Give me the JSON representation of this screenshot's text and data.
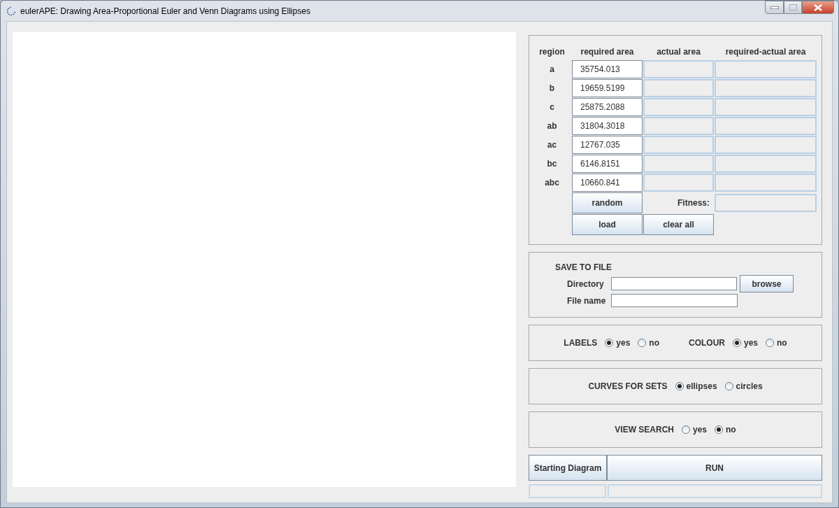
{
  "window": {
    "title": "eulerAPE: Drawing Area-Proportional Euler and Venn Diagrams using Ellipses"
  },
  "areas_table": {
    "columns": [
      "region",
      "required area",
      "actual area",
      "required-actual area"
    ],
    "rows": [
      {
        "region": "a",
        "required_area": "35754.013"
      },
      {
        "region": "b",
        "required_area": "19659.5199"
      },
      {
        "region": "c",
        "required_area": "25875.2088"
      },
      {
        "region": "ab",
        "required_area": "31804.3018"
      },
      {
        "region": "ac",
        "required_area": "12767.035"
      },
      {
        "region": "bc",
        "required_area": "6146.8151"
      },
      {
        "region": "abc",
        "required_area": "10660.841"
      }
    ],
    "random_button": "random",
    "fitness_label": "Fitness:",
    "load_button": "load",
    "clear_button": "clear all"
  },
  "save_to_file": {
    "title": "SAVE TO FILE",
    "directory_label": "Directory",
    "browse_button": "browse",
    "file_name_label": "File name"
  },
  "option_groups": [
    [
      {
        "label": "LABELS",
        "options": [
          {
            "label": "yes",
            "selected": true
          },
          {
            "label": "no",
            "selected": false
          }
        ]
      },
      {
        "label": "COLOUR",
        "options": [
          {
            "label": "yes",
            "selected": true
          },
          {
            "label": "no",
            "selected": false
          }
        ]
      }
    ],
    [
      {
        "label": "CURVES FOR SETS",
        "options": [
          {
            "label": "ellipses",
            "selected": true
          },
          {
            "label": "circles",
            "selected": false
          }
        ]
      }
    ],
    [
      {
        "label": "VIEW SEARCH",
        "options": [
          {
            "label": "yes",
            "selected": false
          },
          {
            "label": "no",
            "selected": true
          }
        ]
      }
    ]
  ],
  "actions": {
    "starting_diagram_button": "Starting Diagram",
    "run_button": "RUN"
  }
}
